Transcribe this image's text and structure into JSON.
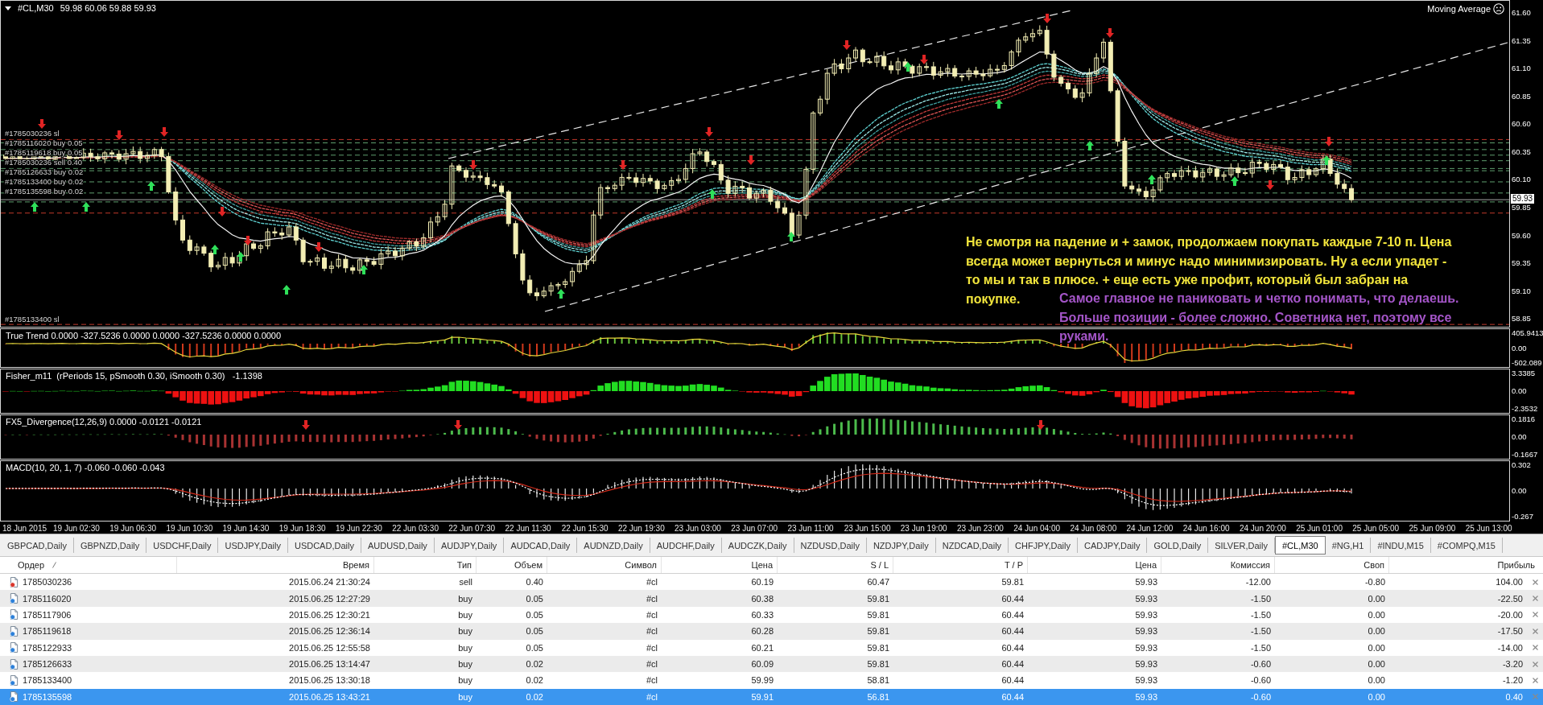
{
  "chart": {
    "symbol": "#CL,M30",
    "ohlc": "59.98 60.06 59.88 59.93",
    "expert": "Moving Average",
    "price_axis": [
      "61.60",
      "61.35",
      "61.10",
      "60.85",
      "60.60",
      "60.35",
      "60.10",
      "59.85",
      "59.60",
      "59.35",
      "59.10",
      "58.85"
    ],
    "current_price": "59.93",
    "order_labels": [
      "#1785030236 sl",
      "#1785116020 buy 0.05",
      "#1785119618 buy 0.05",
      "#1785030236 sell 0.40",
      "#1785126633 buy 0.02",
      "#1785133400 buy 0.02",
      "#1785135598 buy 0.02",
      "#1785133400 sl"
    ],
    "notes": [
      {
        "color": "#f2e53c",
        "lines": [
          "Не смотря на падение и + замок, продолжаем покупать каждые 7-10 п. Цена",
          "всегда может вернуться и минус надо минимизировать. Ну а если упадет -",
          "то мы и так в плюсе. + еще есть уже профит, который был забран на",
          "покупке."
        ]
      },
      {
        "color": "#a455c8",
        "lines": [
          "Самое главное не паниковать и четко понимать, что делаешь.",
          "Больше позиции - более сложно. Советника нет, поэтому все",
          "руками."
        ]
      }
    ]
  },
  "indicators": [
    {
      "kind": "true_trend",
      "title": "True Trend 0.0000 -327.5236 0.0000 0.0000 -327.5236 0.0000 0.0000",
      "axis": [
        "405.9413",
        "0.00",
        "-502.089"
      ]
    },
    {
      "kind": "fisher",
      "title": "Fisher_m11  (rPeriods 15, pSmooth 0.30, iSmooth 0.30)   -1.1398",
      "axis": [
        "3.3385",
        "0.00",
        "-2.3532"
      ]
    },
    {
      "kind": "divergence",
      "title": "FX5_Divergence(12,26,9) 0.0000 -0.0121 -0.0121",
      "axis": [
        "0.1816",
        "0.00",
        "-0.1667"
      ]
    },
    {
      "kind": "macd",
      "title": "MACD(10, 20, 1, 7) -0.060 -0.060 -0.043",
      "axis": [
        "0.302",
        "0.00",
        "-0.267"
      ]
    }
  ],
  "time_axis": [
    "18 Jun 2015",
    "19 Jun 02:30",
    "19 Jun 06:30",
    "19 Jun 10:30",
    "19 Jun 14:30",
    "19 Jun 18:30",
    "19 Jun 22:30",
    "22 Jun 03:30",
    "22 Jun 07:30",
    "22 Jun 11:30",
    "22 Jun 15:30",
    "22 Jun 19:30",
    "23 Jun 03:00",
    "23 Jun 07:00",
    "23 Jun 11:00",
    "23 Jun 15:00",
    "23 Jun 19:00",
    "23 Jun 23:00",
    "24 Jun 04:00",
    "24 Jun 08:00",
    "24 Jun 12:00",
    "24 Jun 16:00",
    "24 Jun 20:00",
    "25 Jun 01:00",
    "25 Jun 05:00",
    "25 Jun 09:00",
    "25 Jun 13:00"
  ],
  "tabs": [
    {
      "label": "GBPCAD,Daily",
      "selected": false
    },
    {
      "label": "GBPNZD,Daily",
      "selected": false
    },
    {
      "label": "USDCHF,Daily",
      "selected": false
    },
    {
      "label": "USDJPY,Daily",
      "selected": false
    },
    {
      "label": "USDCAD,Daily",
      "selected": false
    },
    {
      "label": "AUDUSD,Daily",
      "selected": false
    },
    {
      "label": "AUDJPY,Daily",
      "selected": false
    },
    {
      "label": "AUDCAD,Daily",
      "selected": false
    },
    {
      "label": "AUDNZD,Daily",
      "selected": false
    },
    {
      "label": "AUDCHF,Daily",
      "selected": false
    },
    {
      "label": "AUDCZK,Daily",
      "selected": false
    },
    {
      "label": "NZDUSD,Daily",
      "selected": false
    },
    {
      "label": "NZDJPY,Daily",
      "selected": false
    },
    {
      "label": "NZDCAD,Daily",
      "selected": false
    },
    {
      "label": "CHFJPY,Daily",
      "selected": false
    },
    {
      "label": "CADJPY,Daily",
      "selected": false
    },
    {
      "label": "GOLD,Daily",
      "selected": false
    },
    {
      "label": "SILVER,Daily",
      "selected": false
    },
    {
      "label": "#CL,M30",
      "selected": true
    },
    {
      "label": "#NG,H1",
      "selected": false
    },
    {
      "label": "#INDU,M15",
      "selected": false
    },
    {
      "label": "#COMPQ,M15",
      "selected": false
    }
  ],
  "orders": {
    "columns": [
      "Ордер",
      "Время",
      "Тип",
      "Объем",
      "Символ",
      "Цена",
      "S / L",
      "T / P",
      "Цена",
      "Комиссия",
      "Своп",
      "Прибыль"
    ],
    "rows": [
      {
        "kind": "sell",
        "selected": false,
        "cells": [
          "1785030236",
          "2015.06.24 21:30:24",
          "sell",
          "0.40",
          "#cl",
          "60.19",
          "60.47",
          "59.81",
          "59.93",
          "-12.00",
          "-0.80",
          "104.00"
        ]
      },
      {
        "kind": "buy",
        "selected": false,
        "cells": [
          "1785116020",
          "2015.06.25 12:27:29",
          "buy",
          "0.05",
          "#cl",
          "60.38",
          "59.81",
          "60.44",
          "59.93",
          "-1.50",
          "0.00",
          "-22.50"
        ]
      },
      {
        "kind": "buy",
        "selected": false,
        "cells": [
          "1785117906",
          "2015.06.25 12:30:21",
          "buy",
          "0.05",
          "#cl",
          "60.33",
          "59.81",
          "60.44",
          "59.93",
          "-1.50",
          "0.00",
          "-20.00"
        ]
      },
      {
        "kind": "buy",
        "selected": false,
        "cells": [
          "1785119618",
          "2015.06.25 12:36:14",
          "buy",
          "0.05",
          "#cl",
          "60.28",
          "59.81",
          "60.44",
          "59.93",
          "-1.50",
          "0.00",
          "-17.50"
        ]
      },
      {
        "kind": "buy",
        "selected": false,
        "cells": [
          "1785122933",
          "2015.06.25 12:55:58",
          "buy",
          "0.05",
          "#cl",
          "60.21",
          "59.81",
          "60.44",
          "59.93",
          "-1.50",
          "0.00",
          "-14.00"
        ]
      },
      {
        "kind": "buy",
        "selected": false,
        "cells": [
          "1785126633",
          "2015.06.25 13:14:47",
          "buy",
          "0.02",
          "#cl",
          "60.09",
          "59.81",
          "60.44",
          "59.93",
          "-0.60",
          "0.00",
          "-3.20"
        ]
      },
      {
        "kind": "buy",
        "selected": false,
        "cells": [
          "1785133400",
          "2015.06.25 13:30:18",
          "buy",
          "0.02",
          "#cl",
          "59.99",
          "58.81",
          "60.44",
          "59.93",
          "-0.60",
          "0.00",
          "-1.20"
        ]
      },
      {
        "kind": "buy",
        "selected": true,
        "cells": [
          "1785135598",
          "2015.06.25 13:43:21",
          "buy",
          "0.02",
          "#cl",
          "59.91",
          "56.81",
          "60.44",
          "59.93",
          "-0.60",
          "0.00",
          "0.40"
        ]
      }
    ]
  }
}
